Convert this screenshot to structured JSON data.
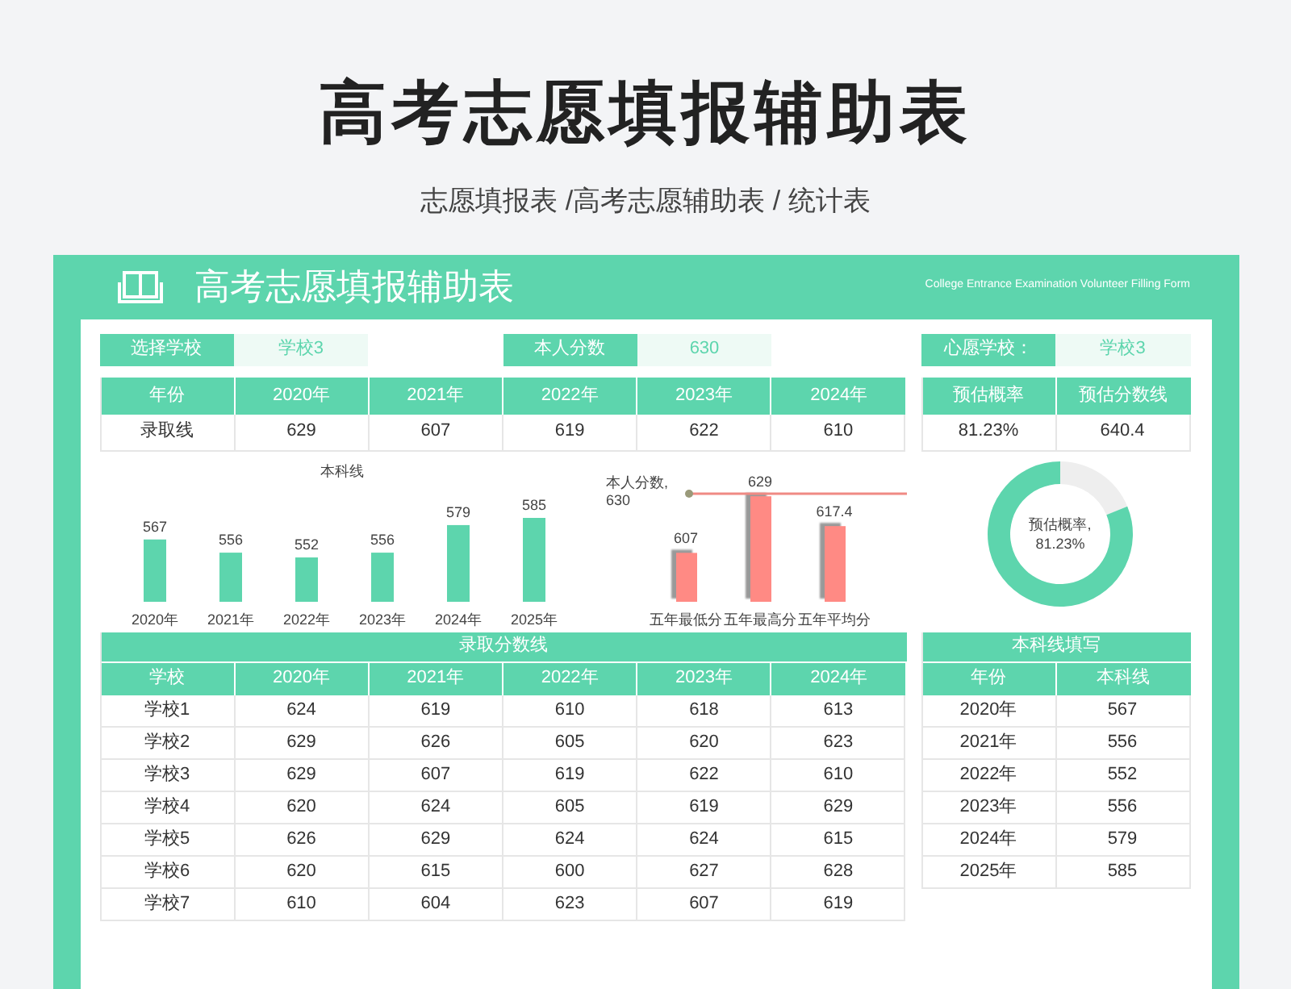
{
  "title": "高考志愿填报辅助表",
  "subtitle": "志愿填报表 /高考志愿辅助表 / 统计表",
  "sheet": {
    "title": "高考志愿填报辅助表",
    "subtitle_en": "College Entrance Examination Volunteer Filling Form",
    "selectors": [
      {
        "label": "选择学校",
        "value": "学校3"
      },
      {
        "label": "本人分数",
        "value": "630"
      },
      {
        "label": "心愿学校：",
        "value": "学校3"
      }
    ],
    "year_table": {
      "columns": [
        "年份",
        "2020年",
        "2021年",
        "2022年",
        "2023年",
        "2024年"
      ],
      "rows": [
        [
          "录取线",
          "629",
          "607",
          "619",
          "622",
          "610"
        ]
      ]
    },
    "estimate_table": {
      "columns": [
        "预估概率",
        "预估分数线"
      ],
      "rows": [
        [
          "81.23%",
          "640.4"
        ]
      ]
    },
    "line_chart": {
      "chart_data": {
        "type": "bar",
        "title": "本科线",
        "categories": [
          "2020年",
          "2021年",
          "2022年",
          "2023年",
          "2024年",
          "2025年"
        ],
        "ylim": [
          515,
          585
        ],
        "data_labels": true,
        "series": [
          {
            "color": "#5dd5ad",
            "values": [
              567,
              556,
              552,
              556,
              579,
              585
            ]
          }
        ]
      }
    },
    "range_chart": {
      "chart_data": {
        "type": "bar",
        "categories": [
          "五年最低分",
          "五年最高分",
          "五年平均分"
        ],
        "ylim": [
          588,
          630
        ],
        "data_labels": true,
        "series": [
          {
            "color": "#ff8a84",
            "values": [
              607,
              629,
              617.4
            ]
          }
        ],
        "ref_lines": [
          {
            "label": "本人分数, 630"
          }
        ]
      }
    },
    "donut": {
      "chart_data": {
        "type": "donut",
        "title": "预估概率,",
        "values": [
          81.23,
          18.77
        ],
        "value_labels": [
          "81.23%",
          null
        ]
      }
    },
    "admission_table": {
      "title": "录取分数线",
      "columns": [
        "学校",
        "2020年",
        "2021年",
        "2022年",
        "2023年",
        "2024年"
      ],
      "rows": [
        [
          "学校1",
          "624",
          "619",
          "610",
          "618",
          "613"
        ],
        [
          "学校2",
          "629",
          "626",
          "605",
          "620",
          "623"
        ],
        [
          "学校3",
          "629",
          "607",
          "619",
          "622",
          "610"
        ],
        [
          "学校4",
          "620",
          "624",
          "605",
          "619",
          "629"
        ],
        [
          "学校5",
          "626",
          "629",
          "624",
          "624",
          "615"
        ],
        [
          "学校6",
          "620",
          "615",
          "600",
          "627",
          "628"
        ],
        [
          "学校7",
          "610",
          "604",
          "623",
          "607",
          "619"
        ]
      ]
    },
    "line_table": {
      "title": "本科线填写",
      "columns": [
        "年份",
        "本科线"
      ],
      "rows": [
        [
          "2020年",
          "567"
        ],
        [
          "2021年",
          "556"
        ],
        [
          "2022年",
          "552"
        ],
        [
          "2023年",
          "556"
        ],
        [
          "2024年",
          "579"
        ],
        [
          "2025年",
          "585"
        ]
      ]
    }
  }
}
